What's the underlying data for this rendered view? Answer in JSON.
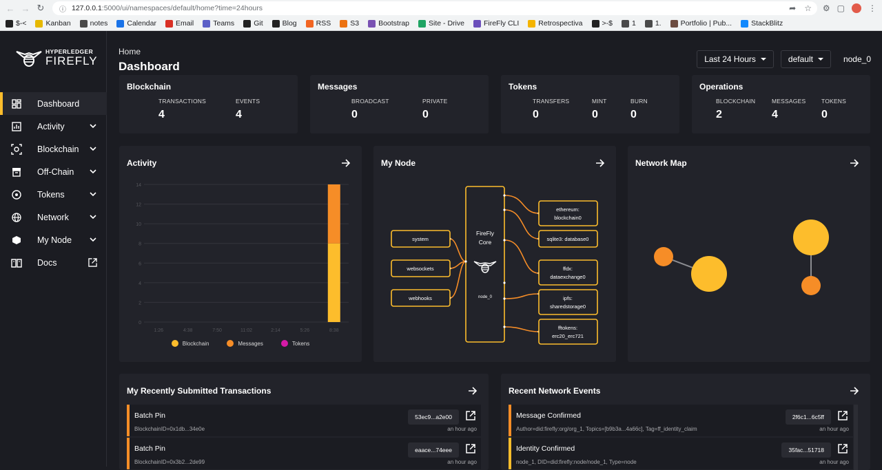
{
  "browser": {
    "url_host": "127.0.0.1",
    "url_path": ":5000/ui/namespaces/default/home?time=24hours",
    "bookmarks": [
      {
        "label": "$-<",
        "icon": "github-icon",
        "color": "#222222"
      },
      {
        "label": "Kanban",
        "icon": "kanban-icon",
        "color": "#e6b800"
      },
      {
        "label": "notes",
        "icon": "folder-icon",
        "color": "#4a4a4a"
      },
      {
        "label": "Calendar",
        "icon": "calendar-icon",
        "color": "#1a73e8"
      },
      {
        "label": "Email",
        "icon": "gmail-icon",
        "color": "#d93025"
      },
      {
        "label": "Teams",
        "icon": "teams-icon",
        "color": "#5b5fc7"
      },
      {
        "label": "Git",
        "icon": "github-icon",
        "color": "#222222"
      },
      {
        "label": "Blog",
        "icon": "github-icon",
        "color": "#222222"
      },
      {
        "label": "RSS",
        "icon": "rss-icon",
        "color": "#f26522"
      },
      {
        "label": "S3",
        "icon": "aws-icon",
        "color": "#ec7211"
      },
      {
        "label": "Bootstrap",
        "icon": "bootstrap-icon",
        "color": "#7952b3"
      },
      {
        "label": "Site - Drive",
        "icon": "drive-icon",
        "color": "#1fa463"
      },
      {
        "label": "FireFly CLI",
        "icon": "firefly-icon",
        "color": "#6b4fbb"
      },
      {
        "label": "Retrospectiva",
        "icon": "bulb-icon",
        "color": "#f4b400"
      },
      {
        "label": ">-$",
        "icon": "github-icon",
        "color": "#222222"
      },
      {
        "label": "1",
        "icon": "folder-icon",
        "color": "#4a4a4a"
      },
      {
        "label": "1.",
        "icon": "folder-icon",
        "color": "#4a4a4a"
      },
      {
        "label": "Portfolio | Pub...",
        "icon": "portfolio-icon",
        "color": "#6d4c41"
      },
      {
        "label": "StackBlitz",
        "icon": "stackblitz-icon",
        "color": "#1389fd"
      }
    ]
  },
  "brand": {
    "small": "HYPERLEDGER",
    "big": "FIREFLY"
  },
  "sidebar": {
    "items": [
      {
        "label": "Dashboard",
        "name": "sidebar-item-dashboard",
        "icon": "dashboard-icon",
        "active": true,
        "chevron": false
      },
      {
        "label": "Activity",
        "name": "sidebar-item-activity",
        "icon": "activity-icon",
        "chevron": true
      },
      {
        "label": "Blockchain",
        "name": "sidebar-item-blockchain",
        "icon": "blockchain-icon",
        "chevron": true
      },
      {
        "label": "Off-Chain",
        "name": "sidebar-item-off-chain",
        "icon": "archive-icon",
        "chevron": true
      },
      {
        "label": "Tokens",
        "name": "sidebar-item-tokens",
        "icon": "token-icon",
        "chevron": true
      },
      {
        "label": "Network",
        "name": "sidebar-item-network",
        "icon": "globe-icon",
        "chevron": true
      },
      {
        "label": "My Node",
        "name": "sidebar-item-my-node",
        "icon": "hexagon-icon",
        "chevron": true
      },
      {
        "label": "Docs",
        "name": "sidebar-item-docs",
        "icon": "docs-icon",
        "external": true
      }
    ]
  },
  "header": {
    "breadcrumb": "Home",
    "title": "Dashboard",
    "time_range": "Last 24 Hours",
    "namespace": "default",
    "node": "node_0"
  },
  "summary": {
    "blockchain": {
      "title": "Blockchain",
      "stats": [
        {
          "label": "TRANSACTIONS",
          "value": "4"
        },
        {
          "label": "EVENTS",
          "value": "4"
        }
      ]
    },
    "messages": {
      "title": "Messages",
      "stats": [
        {
          "label": "BROADCAST",
          "value": "0"
        },
        {
          "label": "PRIVATE",
          "value": "0"
        }
      ]
    },
    "tokens": {
      "title": "Tokens",
      "stats": [
        {
          "label": "TRANSFERS",
          "value": "0"
        },
        {
          "label": "MINT",
          "value": "0"
        },
        {
          "label": "BURN",
          "value": "0"
        }
      ]
    },
    "operations": {
      "title": "Operations",
      "stats": [
        {
          "label": "BLOCKCHAIN",
          "value": "2"
        },
        {
          "label": "MESSAGES",
          "value": "4"
        },
        {
          "label": "TOKENS",
          "value": "0"
        }
      ]
    }
  },
  "activity_card": {
    "title": "Activity"
  },
  "my_node_card": {
    "title": "My Node",
    "left_nodes": [
      "system",
      "websockets",
      "webhooks"
    ],
    "core_label_1": "FireFly",
    "core_label_2": "Core",
    "core_node": "node_0",
    "right_nodes": [
      [
        "ethereum:",
        "blockchain0"
      ],
      [
        "sqlite3: database0"
      ],
      [
        "ffdx:",
        "dataexchange0"
      ],
      [
        "ipfs:",
        "sharedstorage0"
      ],
      [
        "fftokens:",
        "erc20_erc721"
      ]
    ]
  },
  "network_map_card": {
    "title": "Network Map"
  },
  "chart_data": {
    "type": "bar",
    "stacked": true,
    "categories": [
      "1:26",
      "4:38",
      "7:50",
      "11:02",
      "2:14",
      "5:26",
      "8:38"
    ],
    "ylim": [
      0,
      14
    ],
    "yticks": [
      0,
      2,
      4,
      6,
      8,
      10,
      12,
      14
    ],
    "series": [
      {
        "name": "Blockchain",
        "color": "#fdbd2c",
        "values": [
          0,
          0,
          0,
          0,
          0,
          0,
          8
        ]
      },
      {
        "name": "Messages",
        "color": "#f68d27",
        "values": [
          0,
          0,
          0,
          0,
          0,
          0,
          6
        ]
      },
      {
        "name": "Tokens",
        "color": "#d51aa7",
        "values": [
          0,
          0,
          0,
          0,
          0,
          0,
          0
        ]
      }
    ],
    "legend_position": "bottom",
    "grid": true
  },
  "transactions": {
    "title": "My Recently Submitted Transactions",
    "rows": [
      {
        "name": "Batch Pin",
        "sub": "BlockchainID=0x1db...34e0e",
        "id": "53ec9...a2e00",
        "time": "an hour ago"
      },
      {
        "name": "Batch Pin",
        "sub": "BlockchainID=0x3b2...2de99",
        "id": "eaace...74eee",
        "time": "an hour ago"
      }
    ]
  },
  "events": {
    "title": "Recent Network Events",
    "rows": [
      {
        "name": "Message Confirmed",
        "sub": "Author=did:firefly:org/org_1, Topics=[b9b3a...4a66c], Tag=ff_identity_claim",
        "id": "2f6c1...6c5ff",
        "time": "an hour ago",
        "color": "orange"
      },
      {
        "name": "Identity Confirmed",
        "sub": "node_1, DID=did:firefly:node/node_1, Type=node",
        "id": "35fac...51718",
        "time": "an hour ago",
        "color": "yellow"
      }
    ]
  },
  "colors": {
    "accent": "#fdbd2c",
    "orange": "#f68d27",
    "magenta": "#d51aa7",
    "card": "#22232a",
    "bg": "#1b1c22"
  }
}
